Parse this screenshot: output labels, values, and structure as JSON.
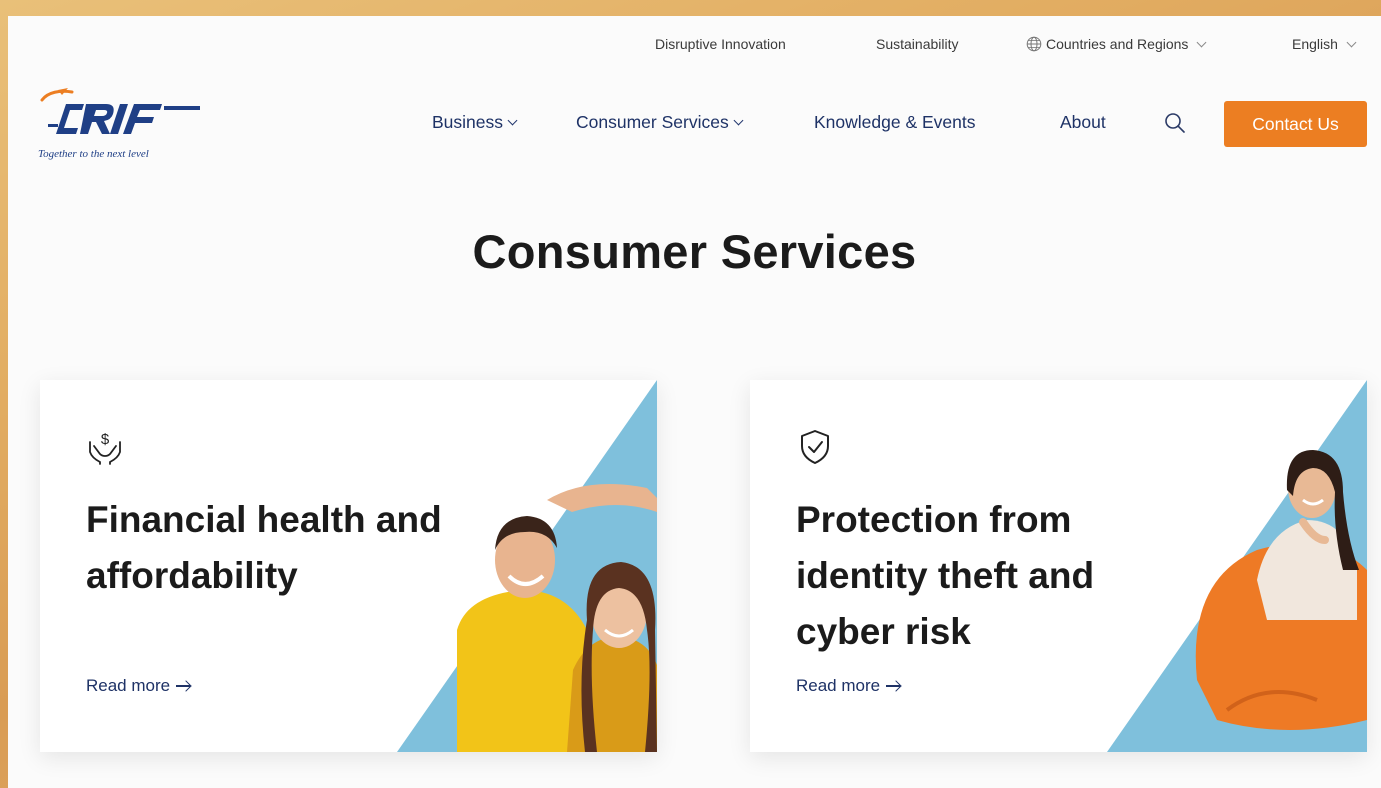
{
  "utility_nav": {
    "disruptive": "Disruptive Innovation",
    "sustainability": "Sustainability",
    "countries": "Countries and Regions",
    "language": "English"
  },
  "logo": {
    "wordmark": "CRIF",
    "tagline": "Together to the next level"
  },
  "main_nav": {
    "business": "Business",
    "consumer_services": "Consumer Services",
    "knowledge_events": "Knowledge & Events",
    "about": "About",
    "contact": "Contact Us"
  },
  "page": {
    "title": "Consumer Services"
  },
  "cards": [
    {
      "icon": "hands-dollar-icon",
      "title": "Financial health and affordability",
      "cta": "Read more"
    },
    {
      "icon": "shield-check-icon",
      "title": "Protection from identity theft and cyber risk",
      "cta": "Read more"
    }
  ],
  "colors": {
    "navy": "#1e3266",
    "orange": "#ec7e22",
    "sky": "#7fc0dc"
  }
}
